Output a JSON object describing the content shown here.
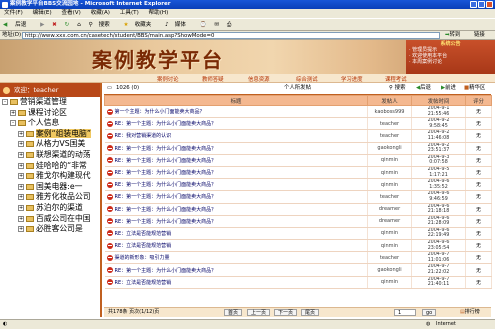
{
  "window": {
    "title": "案例教学平台BBS交流园地 - Microsoft Internet Explorer"
  },
  "menu": [
    "文件(F)",
    "编辑(E)",
    "查看(V)",
    "收藏(A)",
    "工具(T)",
    "帮助(H)"
  ],
  "toolbar": {
    "back": "后退",
    "search": "搜索",
    "favorites": "收藏夹",
    "media": "媒体"
  },
  "address": {
    "label": "地址(D)",
    "url": "http://www.xxx.com.cn/casetech/student/BBS/main.asp?ShowMode=0",
    "go": "转到",
    "links": "链接"
  },
  "banner": {
    "logo": "案例教学平台",
    "notice_title": "系统公告",
    "notices": [
      "· 管理员提示",
      "· 欢迎使用本平台",
      "· 本周案例讨论"
    ]
  },
  "nav": [
    "案例讨论",
    "教师答疑",
    "信息资源",
    "综合测试",
    "学习进度",
    "课程考试"
  ],
  "sidebar": {
    "welcome": "欢迎：teacher",
    "tree": [
      {
        "label": "营销渠道管理",
        "level": 0,
        "sign": "-"
      },
      {
        "label": "课程讨论区",
        "level": 1,
        "sign": "+"
      },
      {
        "label": "个人信息",
        "level": 1,
        "sign": "-"
      },
      {
        "label": "案例“组装电脑”",
        "level": 2,
        "sign": "+",
        "highlight": true
      },
      {
        "label": "从格力VS国美",
        "level": 2,
        "sign": "+"
      },
      {
        "label": "联想渠道的动荡",
        "level": 2,
        "sign": "+"
      },
      {
        "label": "娃哈哈的“非常",
        "level": 2,
        "sign": "+"
      },
      {
        "label": "雅戈尔构建现代",
        "level": 2,
        "sign": "+"
      },
      {
        "label": "国美电器:e一",
        "level": 2,
        "sign": "+"
      },
      {
        "label": "雅芳化妆品公司",
        "level": 2,
        "sign": "+"
      },
      {
        "label": "苏泊尔的渠道",
        "level": 2,
        "sign": "+"
      },
      {
        "label": "百威公司在中国",
        "level": 2,
        "sign": "+"
      },
      {
        "label": "必胜客公司是",
        "level": 2,
        "sign": "+"
      }
    ]
  },
  "content": {
    "breadcrumb": "1026 (0)",
    "board_label": "个人所发帖",
    "actions": [
      "搜索",
      "后退",
      "前进",
      "精华区"
    ],
    "headers": [
      "标题",
      "发帖人",
      "发帖时间",
      "评分"
    ],
    "rows": [
      {
        "title": "第一个主题：为什么小门面能卖大商品？",
        "author": "kaoboss999",
        "d": "2004-9-1",
        "t": "21:55:46",
        "score": "无"
      },
      {
        "title": "RE：第一个主题：为什么小门面能卖大商品？",
        "author": "teacher",
        "d": "2004-9-2",
        "t": "9:58:45",
        "score": "无"
      },
      {
        "title": "RE：我对营销渠道的认识",
        "author": "teacher",
        "d": "2004-9-2",
        "t": "11:46:08",
        "score": "无"
      },
      {
        "title": "RE：第一个主题：为什么小门面能卖大商品？",
        "author": "gaokongli",
        "d": "2004-9-2",
        "t": "23:51:37",
        "score": "无"
      },
      {
        "title": "RE：第一个主题：为什么小门面能卖大商品？",
        "author": "qinmin",
        "d": "2004-9-3",
        "t": "0:07:58",
        "score": "无"
      },
      {
        "title": "RE：第一个主题：为什么小门面能卖大商品？",
        "author": "qinmin",
        "d": "2004-9-5",
        "t": "1:17:21",
        "score": "无"
      },
      {
        "title": "RE：第一个主题：为什么小门面能卖大商品？",
        "author": "qinmin",
        "d": "2004-9-6",
        "t": "1:35:52",
        "score": "无"
      },
      {
        "title": "RE：第一个主题：为什么小门面能卖大商品？",
        "author": "teacher",
        "d": "2004-9-6",
        "t": "9:46:59",
        "score": "无"
      },
      {
        "title": "RE：第一个主题：为什么小门面能卖大商品？",
        "author": "dreamer",
        "d": "2004-9-6",
        "t": "21:18:18",
        "score": "无"
      },
      {
        "title": "RE：第一个主题：为什么小门面能卖大商品？",
        "author": "dreamer",
        "d": "2004-9-6",
        "t": "21:28:09",
        "score": "无"
      },
      {
        "title": "RE：立法是否能规范营销",
        "author": "qinmin",
        "d": "2004-9-6",
        "t": "22:19:49",
        "score": "无"
      },
      {
        "title": "RE：立法是否能规范营销",
        "author": "qinmin",
        "d": "2004-9-6",
        "t": "23:05:54",
        "score": "无"
      },
      {
        "title": "渠道的新形象：吸引力量",
        "author": "teacher",
        "d": "2004-9-7",
        "t": "11:01:06",
        "score": "无"
      },
      {
        "title": "RE：第一个主题：为什么小门面能卖大商品？",
        "author": "gaokongli",
        "d": "2004-9-7",
        "t": "21:22:02",
        "score": "无"
      },
      {
        "title": "RE：立法是否能规范营销",
        "author": "qinmin",
        "d": "2004-9-7",
        "t": "21:40:11",
        "score": "无"
      }
    ]
  },
  "pager": {
    "summary": "共178条  页次(1/12)页",
    "buttons": [
      "首页",
      "上一页",
      "下一页",
      "尾页"
    ],
    "page": "1",
    "go": "go",
    "sort": "排行榜"
  },
  "status": {
    "zone": "Internet"
  }
}
